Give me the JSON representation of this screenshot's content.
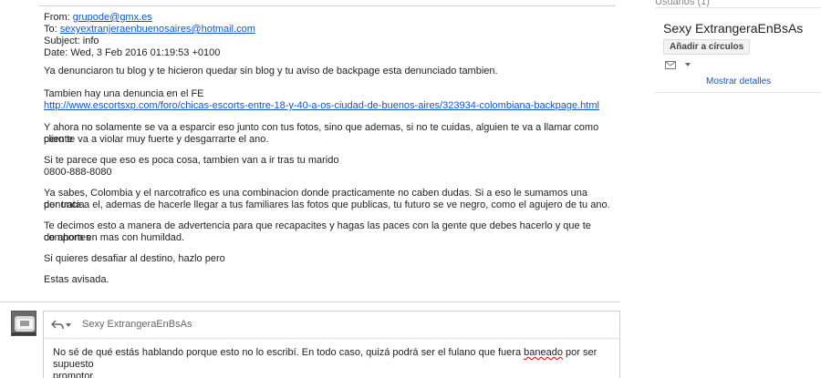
{
  "quoted_mail": {
    "from_label": "From: ",
    "from_email": "grupode@gmx.es",
    "to_label": "To: ",
    "to_email": "sexyextranjeraenbuenosaires@hotmail.com",
    "subject": "Subject: info",
    "date": "Date: Wed, 3 Feb 2016 01:19:53 +0100",
    "paragraphs": [
      "Ya denunciaron tu blog y te hicieron quedar sin blog y tu aviso de backpage esta denunciado tambien.",
      "Tambien hay una denuncia en el FE",
      "http://www.escortsxp.com/foro/chicas-escorts-entre-18-y-40-a-os-ciudad-de-buenos-aires/323934-colombiana-backpage.html",
      "Y ahora no solamente se va a esparcir eso junto con tus fotos, sino que ademas, si no te cuidas, alguien te va a llamar como cliente",
      "pero te va a violar muy fuerte y desgarrarte el ano.",
      "Si te parece que eso es poca cosa, tambien van a ir tras tu marido",
      "0800-888-8080",
      "Ya sabes, Colombia y el narcotrafico es una combinacion donde practicamente no caben dudas. Si a eso le sumamos una denuncia",
      "por trata a el, ademas de hacerle llegar a tus familiares las fotos que publicas, tu futuro se ve negro, como el agujero de tu ano.",
      "Te decimos esto a manera de advertencia para que recapacites y hagas las paces con la gente que debes hacerlo y que te comportes",
      "de ahora en mas con humildad.",
      "Si quieres desafiar al destino, hazlo pero",
      "Estas avisada."
    ]
  },
  "contact_card": {
    "top_partial_text": "Usuarios (1)",
    "name": "Sexy ExtrangeraEnBsAs",
    "add_circles_label": "Añadir a círculos",
    "show_details_label": "Mostrar detalles"
  },
  "reply": {
    "to_name": "Sexy ExtrangeraEnBsAs",
    "text_before": "No sé de qué estás hablando porque esto no lo escribí. En todo caso, quizá podrá ser el fulano que fuera ",
    "misspelled_word": "baneado",
    "text_after": " por ser supuesto",
    "text_line2": "promotor."
  }
}
